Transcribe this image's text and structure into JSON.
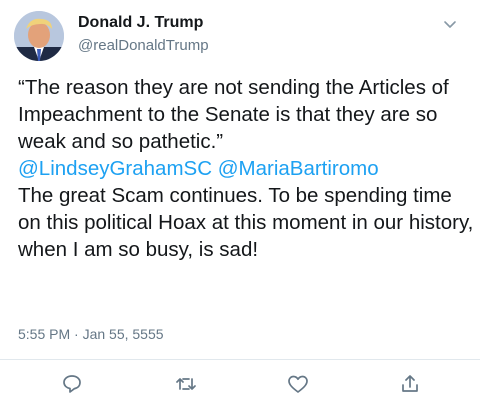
{
  "author": {
    "name": "Donald J. Trump",
    "handle": "@realDonaldTrump"
  },
  "tweet": {
    "text_part1": "“The reason they are not sending the Articles of Impeachment to the Senate is that they are so weak and so pathetic.”",
    "mention1": "@LindseyGrahamSC",
    "mention2": "@MariaBartiromo",
    "text_part2": "The great Scam continues. To be spending time on this political Hoax at this moment in our history, when I am so busy, is sad!",
    "timestamp": "5:55 PM · Jan 55, 5555"
  },
  "icons": {
    "menu": "chevron-down-icon",
    "reply": "reply-icon",
    "retweet": "retweet-icon",
    "like": "heart-icon",
    "share": "share-icon"
  },
  "colors": {
    "text": "#14171a",
    "secondary": "#657786",
    "link": "#1da1f2",
    "divider": "#e1e8ed"
  }
}
